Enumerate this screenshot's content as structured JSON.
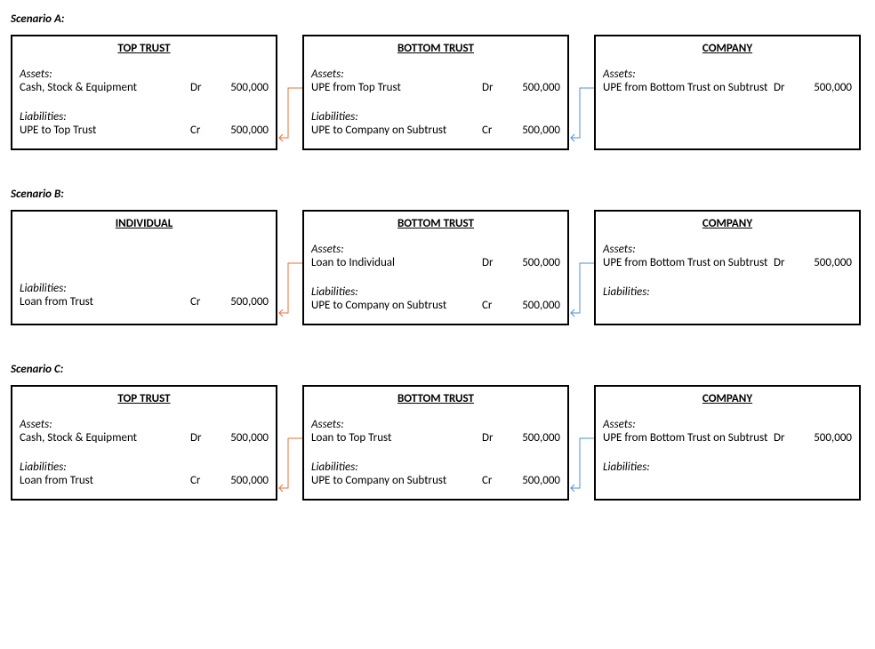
{
  "scenarios": [
    {
      "label": "Scenario A:",
      "boxes": [
        {
          "title": "TOP TRUST",
          "assets_label": "Assets:",
          "asset_items": [
            {
              "desc": "Cash, Stock & Equipment",
              "drcr": "Dr",
              "amt": "500,000"
            }
          ],
          "liab_label": "Liabilities:",
          "liab_items": [
            {
              "desc": "UPE to Top Trust",
              "drcr": "Cr",
              "amt": "500,000"
            }
          ]
        },
        {
          "title": "BOTTOM TRUST",
          "assets_label": "Assets:",
          "asset_items": [
            {
              "desc": "UPE from Top Trust",
              "drcr": "Dr",
              "amt": "500,000"
            }
          ],
          "liab_label": "Liabilities:",
          "liab_items": [
            {
              "desc": "UPE to Company on Subtrust",
              "drcr": "Cr",
              "amt": "500,000"
            }
          ]
        },
        {
          "title": "COMPANY",
          "assets_label": "Assets:",
          "asset_items": [
            {
              "desc": "UPE from Bottom Trust on Subtrust",
              "drcr": "Dr",
              "amt": "500,000"
            }
          ],
          "liab_label": "",
          "liab_items": []
        }
      ]
    },
    {
      "label": "Scenario B:",
      "boxes": [
        {
          "title": "INDIVIDUAL",
          "assets_label": "",
          "asset_items": [],
          "liab_label": "Liabilities:",
          "liab_items": [
            {
              "desc": "Loan from Trust",
              "drcr": "Cr",
              "amt": "500,000"
            }
          ]
        },
        {
          "title": "BOTTOM TRUST",
          "assets_label": "Assets:",
          "asset_items": [
            {
              "desc": "Loan to Individual",
              "drcr": "Dr",
              "amt": "500,000"
            }
          ],
          "liab_label": "Liabilities:",
          "liab_items": [
            {
              "desc": "UPE to Company on Subtrust",
              "drcr": "Cr",
              "amt": "500,000"
            }
          ]
        },
        {
          "title": "COMPANY",
          "assets_label": "Assets:",
          "asset_items": [
            {
              "desc": "UPE from Bottom Trust on Subtrust",
              "drcr": "Dr",
              "amt": "500,000"
            }
          ],
          "liab_label": "Liabilities:",
          "liab_items": []
        }
      ]
    },
    {
      "label": "Scenario C:",
      "boxes": [
        {
          "title": "TOP TRUST",
          "assets_label": "Assets:",
          "asset_items": [
            {
              "desc": "Cash, Stock & Equipment",
              "drcr": "Dr",
              "amt": "500,000"
            }
          ],
          "liab_label": "Liabilities:",
          "liab_items": [
            {
              "desc": "Loan from Trust",
              "drcr": "Cr",
              "amt": "500,000"
            }
          ]
        },
        {
          "title": "BOTTOM TRUST",
          "assets_label": "Assets:",
          "asset_items": [
            {
              "desc": "Loan to Top Trust",
              "drcr": "Dr",
              "amt": "500,000"
            }
          ],
          "liab_label": "Liabilities:",
          "liab_items": [
            {
              "desc": "UPE to Company on Subtrust",
              "drcr": "Cr",
              "amt": "500,000"
            }
          ]
        },
        {
          "title": "COMPANY",
          "assets_label": "Assets:",
          "asset_items": [
            {
              "desc": "UPE from Bottom Trust on Subtrust",
              "drcr": "Dr",
              "amt": "500,000"
            }
          ],
          "liab_label": "Liabilities:",
          "liab_items": []
        }
      ]
    }
  ],
  "colors": {
    "arrow_orange": "#E97132",
    "arrow_blue": "#4A90D9"
  }
}
